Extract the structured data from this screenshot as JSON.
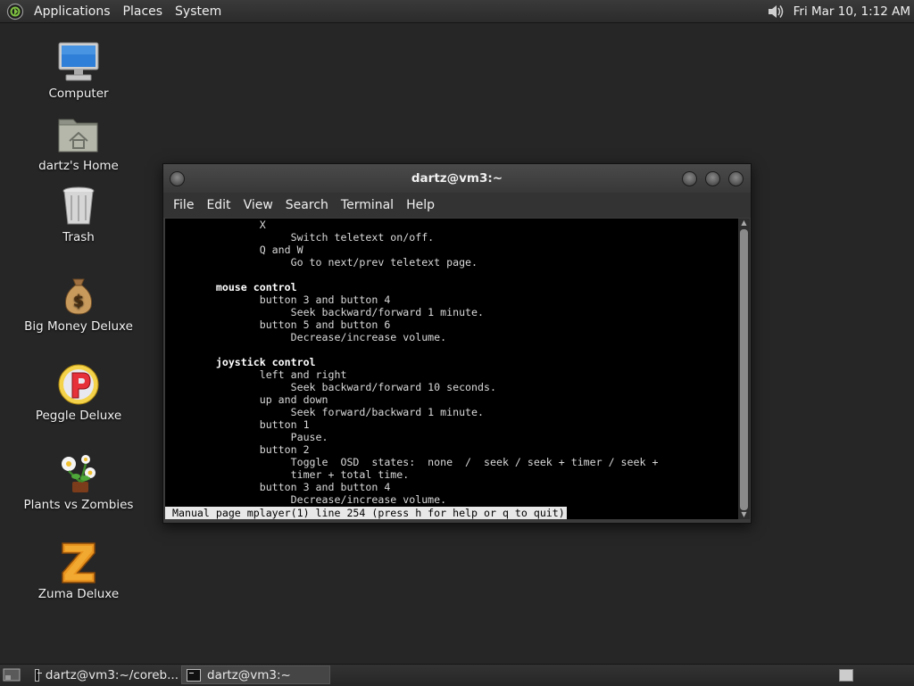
{
  "top_panel": {
    "menus": [
      "Applications",
      "Places",
      "System"
    ],
    "clock": "Fri Mar 10,  1:12 AM",
    "tray_icons": [
      "volume-icon"
    ]
  },
  "desktop": {
    "icons": [
      {
        "label": "Computer",
        "icon": "computer-icon"
      },
      {
        "label": "dartz's Home",
        "icon": "home-folder-icon"
      },
      {
        "label": "Trash",
        "icon": "trash-icon"
      },
      {
        "label": "Big Money Deluxe",
        "icon": "money-bag-icon"
      },
      {
        "label": "Peggle Deluxe",
        "icon": "peggle-icon"
      },
      {
        "label": "Plants vs Zombies",
        "icon": "plants-icon"
      },
      {
        "label": "Zuma Deluxe",
        "icon": "zuma-icon"
      }
    ]
  },
  "terminal": {
    "title": "dartz@vm3:~",
    "menus": [
      "File",
      "Edit",
      "View",
      "Search",
      "Terminal",
      "Help"
    ],
    "lines": [
      {
        "text": "              X",
        "bold": false
      },
      {
        "text": "                   Switch teletext on/off.",
        "bold": false
      },
      {
        "text": "              Q and W",
        "bold": false
      },
      {
        "text": "                   Go to next/prev teletext page.",
        "bold": false
      },
      {
        "text": "",
        "bold": false
      },
      {
        "text": "       mouse control",
        "bold": true
      },
      {
        "text": "              button 3 and button 4",
        "bold": false
      },
      {
        "text": "                   Seek backward/forward 1 minute.",
        "bold": false
      },
      {
        "text": "              button 5 and button 6",
        "bold": false
      },
      {
        "text": "                   Decrease/increase volume.",
        "bold": false
      },
      {
        "text": "",
        "bold": false
      },
      {
        "text": "       joystick control",
        "bold": true
      },
      {
        "text": "              left and right",
        "bold": false
      },
      {
        "text": "                   Seek backward/forward 10 seconds.",
        "bold": false
      },
      {
        "text": "              up and down",
        "bold": false
      },
      {
        "text": "                   Seek forward/backward 1 minute.",
        "bold": false
      },
      {
        "text": "              button 1",
        "bold": false
      },
      {
        "text": "                   Pause.",
        "bold": false
      },
      {
        "text": "              button 2",
        "bold": false
      },
      {
        "text": "                   Toggle  OSD  states:  none  /  seek / seek + timer / seek +",
        "bold": false
      },
      {
        "text": "                   timer + total time.",
        "bold": false
      },
      {
        "text": "              button 3 and button 4",
        "bold": false
      },
      {
        "text": "                   Decrease/increase volume.",
        "bold": false
      }
    ],
    "status_line": "Manual page mplayer(1) line 254 (press h for help or q to quit)"
  },
  "taskbar": {
    "tasks": [
      {
        "label": "dartz@vm3:~/coreb...",
        "active": false
      },
      {
        "label": "dartz@vm3:~",
        "active": true
      }
    ]
  }
}
